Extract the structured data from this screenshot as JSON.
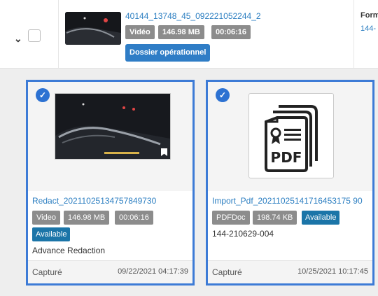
{
  "top_row": {
    "title": "40144_13748_45_092221052244_2",
    "badges": [
      "Vidéo",
      "146.98 MB",
      "00:06:16"
    ],
    "button_label": "Dossier opérationnel",
    "right_label": "Form",
    "right_value": "144-"
  },
  "cards": [
    {
      "title": "Redact_20211025134757849730",
      "badges": [
        "Video",
        "146.98 MB",
        "00:06:16"
      ],
      "status": "Available",
      "note": "Advance Redaction",
      "footer_label": "Capturé",
      "footer_date": "09/22/2021 04:17:39"
    },
    {
      "title": "Import_Pdf_20211025141716453175 90",
      "badges": [
        "PDFDoc",
        "198.74 KB"
      ],
      "status": "Available",
      "note": "144-210629-004",
      "footer_label": "Capturé",
      "footer_date": "10/25/2021 10:17:45"
    }
  ],
  "colors": {
    "selection_border": "#3d7bd6",
    "link": "#2b7ec1",
    "available": "#1b75a8",
    "grey_badge": "#8c8c8c",
    "button": "#2f7dc6"
  }
}
